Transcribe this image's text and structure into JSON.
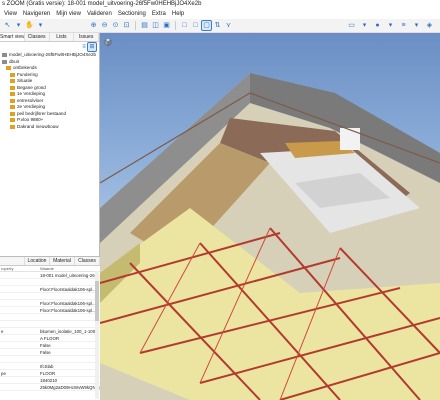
{
  "window": {
    "title": "s ZOOM (Gratis versie): 18-001 model_uitvoering-26f5Fw0HEHBjJO4Xe2b"
  },
  "menu": [
    "View",
    "Navigeren",
    "Mijn view",
    "Valideren",
    "Sectioning",
    "Extra",
    "Help"
  ],
  "left_tabs": [
    "Smart views",
    "Classes",
    "Lists",
    "Issues"
  ],
  "tree": [
    {
      "label": "model_uitvoering-26f5Fw0HEHBjJO4Xe2b",
      "level": 0,
      "color": "#8c8c8c"
    },
    {
      "label": "dbuit",
      "level": 0,
      "color": "#8c8c8c"
    },
    {
      "label": "ontbekends",
      "level": 1,
      "color": "#e0a020"
    },
    {
      "label": "Fundering",
      "level": 2,
      "color": "#e0a020"
    },
    {
      "label": "Situatie",
      "level": 2,
      "color": "#e0a020"
    },
    {
      "label": "Begane grond",
      "level": 2,
      "color": "#e0a020"
    },
    {
      "label": "1e Verdieping",
      "level": 2,
      "color": "#e0a020"
    },
    {
      "label": "entresolvloer",
      "level": 2,
      "color": "#e0a020"
    },
    {
      "label": "2e Verdieping",
      "level": 2,
      "color": "#e0a020"
    },
    {
      "label": "peil bedrijfsrer bestaand",
      "level": 2,
      "color": "#e0a020"
    },
    {
      "label": "P.vloo 9880+",
      "level": 2,
      "color": "#e0a020"
    },
    {
      "label": "Dakrand nieuwbouw",
      "level": 2,
      "color": "#e0a020"
    }
  ],
  "props_tabs": [
    "",
    "Location",
    "Material",
    "Classes"
  ],
  "props_header": {
    "name": "roperty",
    "value": "Waarde"
  },
  "props": [
    {
      "name": "",
      "value": "18-001 model_uitvoering-26..."
    },
    {
      "name": "",
      "value": ""
    },
    {
      "name": "",
      "value": "Floor:Floorstaaldak106-spl..."
    },
    {
      "name": "",
      "value": ""
    },
    {
      "name": "",
      "value": "Floor:Floorstaaldak106-spl..."
    },
    {
      "name": "",
      "value": "Floor:Floorstaaldak106-spl..."
    },
    {
      "name": "",
      "value": ""
    },
    {
      "name": "",
      "value": ""
    },
    {
      "name": "e",
      "value": "bitumen_isolatie_100_1-100..."
    },
    {
      "name": "",
      "value": "A FLOOR"
    },
    {
      "name": "",
      "value": "False"
    },
    {
      "name": "",
      "value": "False"
    },
    {
      "name": "",
      "value": ""
    },
    {
      "name": "",
      "value": "IfcSlab"
    },
    {
      "name": "pe",
      "value": "FLOOR"
    },
    {
      "name": "",
      "value": "1840210"
    },
    {
      "name": "",
      "value": "25k0Mg2aD09HcWvW9kQNrg"
    }
  ],
  "colors": {
    "accent": "#2a6fc9",
    "sky_top": "#6a8ec4",
    "sky_bottom": "#dfe9f6",
    "beam_red": "#c0302a",
    "floor_yellow": "#e9e3a0",
    "wall_brown": "#8b6a58",
    "roof_grey": "#7f7f7f"
  },
  "icons": {
    "nav_cube": "cube-icon",
    "toolbar": [
      "select-icon",
      "orbit-icon",
      "zoom-icon",
      "section-icon"
    ]
  }
}
